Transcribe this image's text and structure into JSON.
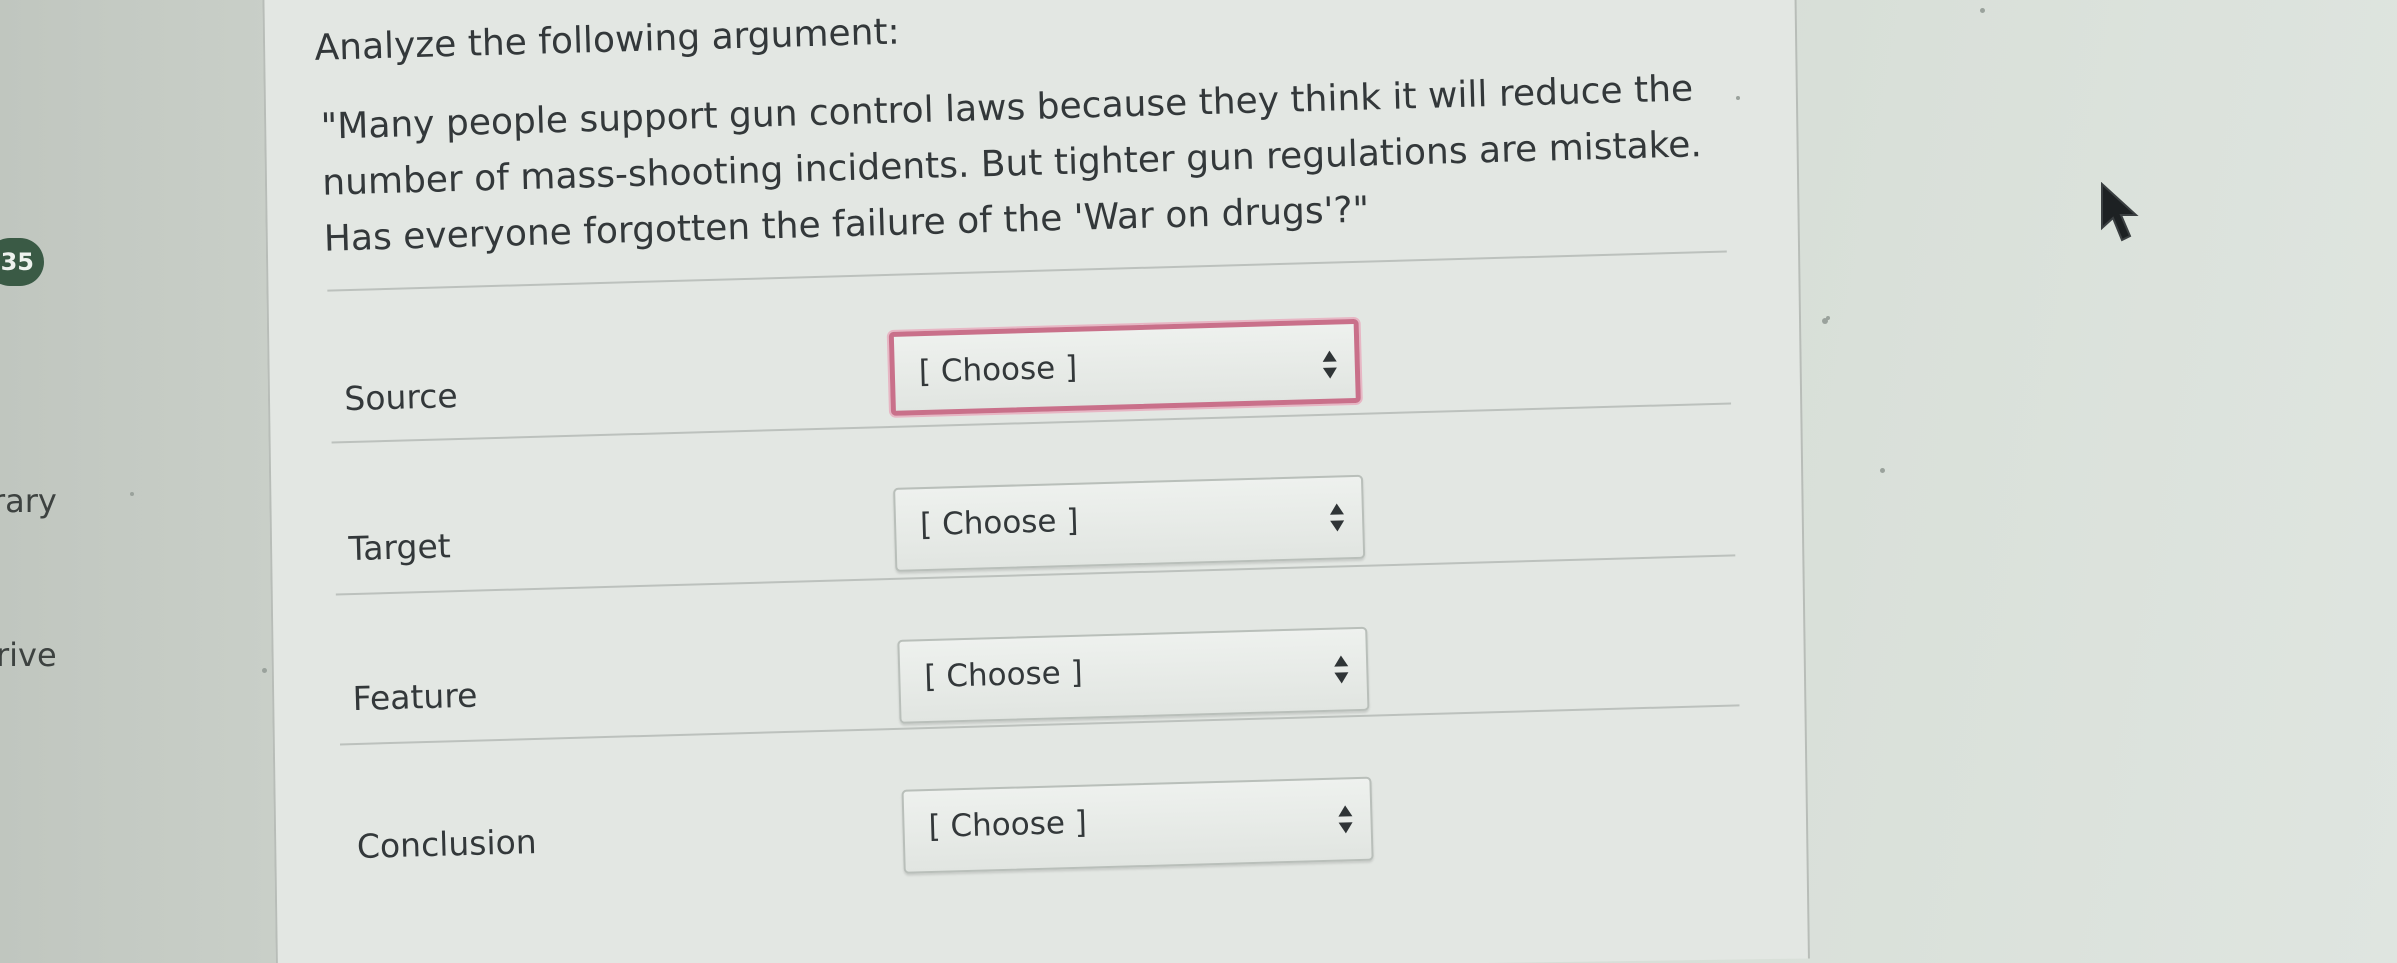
{
  "sidebar": {
    "badge": "35",
    "items": [
      {
        "label": "rary"
      },
      {
        "label": "rive"
      }
    ]
  },
  "question": {
    "title": "Analyze the following argument:",
    "quote": "\"Many people support gun control laws because they think it will reduce the number of mass-shooting incidents. But tighter gun regulations are mistake. Has everyone forgotten the failure of the 'War on drugs'?\""
  },
  "rows": [
    {
      "label": "Source",
      "value": "[ Choose ]",
      "focused": true
    },
    {
      "label": "Target",
      "value": "[ Choose ]",
      "focused": false
    },
    {
      "label": "Feature",
      "value": "[ Choose ]",
      "focused": false
    },
    {
      "label": "Conclusion",
      "value": "[ Choose ]",
      "focused": false
    }
  ],
  "colors": {
    "badge": "#3a5a45",
    "focus_ring": "#c9708a"
  },
  "icons": {
    "select_arrows": "up-down-caret-icon",
    "cursor": "mouse-pointer-icon"
  }
}
